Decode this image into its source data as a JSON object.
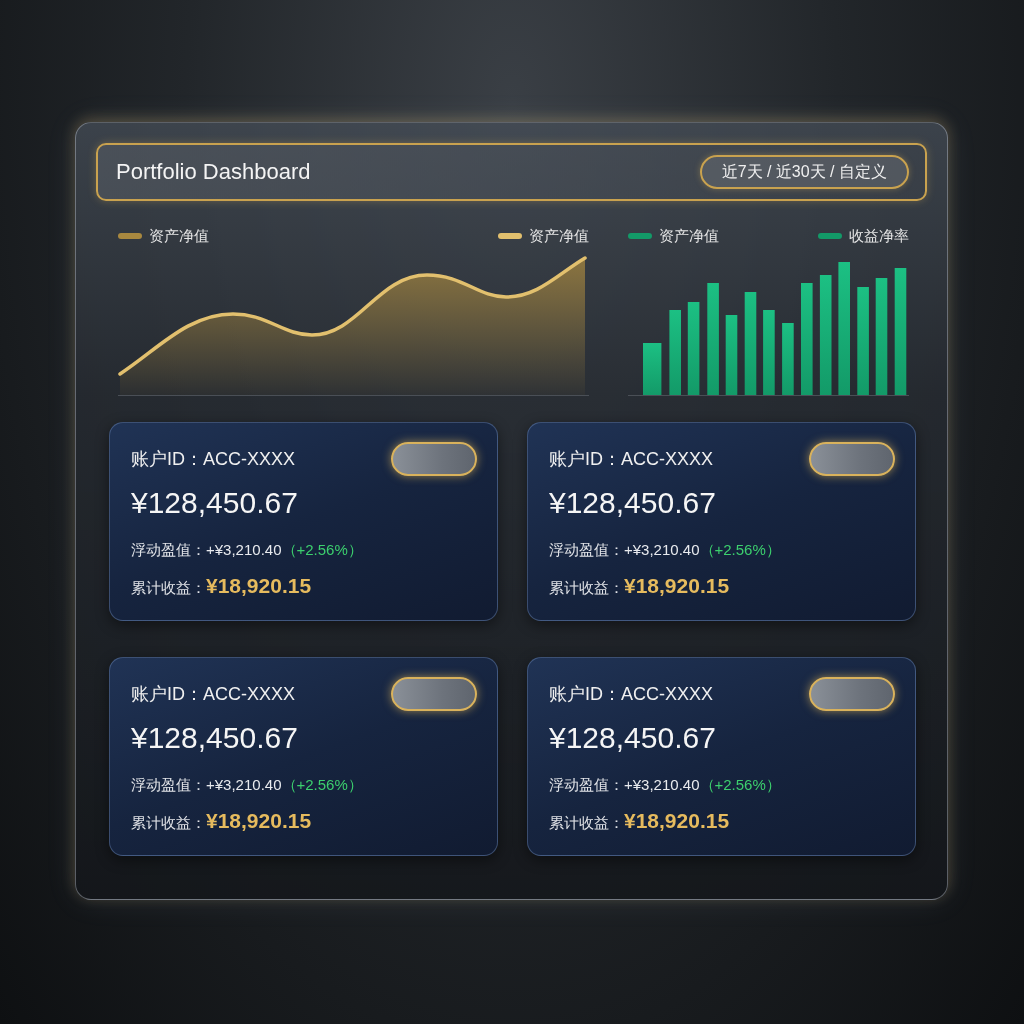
{
  "header": {
    "title": "Portfolio Dashboard",
    "range_selector": "近7天 / 近30天 / 自定义"
  },
  "charts": [
    {
      "kind": "area",
      "legend": [
        {
          "label": "资产净值",
          "color": "#a8883f"
        },
        {
          "label": "资产净值",
          "color": "#e2c06e"
        }
      ]
    },
    {
      "kind": "bar",
      "legend": [
        {
          "label": "资产净值",
          "color": "#139a68"
        },
        {
          "label": "收益净率",
          "color": "#139a68"
        }
      ]
    }
  ],
  "cards": [
    {
      "account": "账户ID：ACC-XXXX",
      "balance": "¥128,450.67",
      "float_label": "浮动盈值：",
      "float_value": "+¥3,210.40",
      "float_change": "（+2.56%）",
      "total_label": "累计收益：",
      "total_value": "¥18,920.15"
    },
    {
      "account": "账户ID：ACC-XXXX",
      "balance": "¥128,450.67",
      "float_label": "浮动盈值：",
      "float_value": "+¥3,210.40",
      "float_change": "（+2.56%）",
      "total_label": "累计收益：",
      "total_value": "¥18,920.15"
    },
    {
      "account": "账户ID：ACC-XXXX",
      "balance": "¥128,450.67",
      "float_label": "浮动盈值：",
      "float_value": "+¥3,210.40",
      "float_change": "（+2.56%）",
      "total_label": "累计收益：",
      "total_value": "¥18,920.15"
    },
    {
      "account": "账户ID：ACC-XXXX",
      "balance": "¥128,450.67",
      "float_label": "浮动盈值：",
      "float_value": "+¥3,210.40",
      "float_change": "（+2.56%）",
      "total_label": "累计收益：",
      "total_value": "¥18,920.15"
    }
  ]
}
